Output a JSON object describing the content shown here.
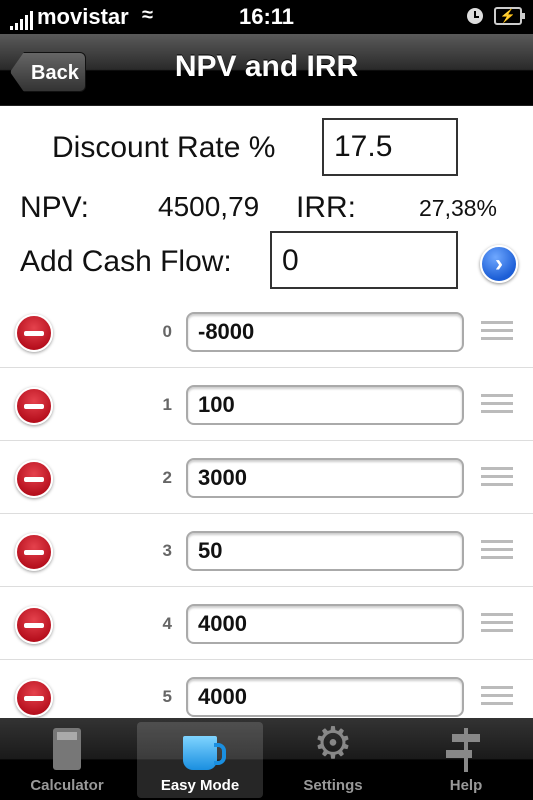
{
  "status_bar": {
    "carrier": "movistar",
    "time": "16:11",
    "wifi_icon": "wifi-icon",
    "clock_icon": "alarm-clock-icon",
    "battery_icon": "battery-charging-icon"
  },
  "nav": {
    "back_label": "Back",
    "title": "NPV and IRR"
  },
  "form": {
    "discount_rate_label": "Discount Rate %",
    "discount_rate_value": "17.5",
    "npv_label": "NPV:",
    "npv_value": "4500,79",
    "irr_label": "IRR:",
    "irr_value": "27,38%",
    "add_cash_flow_label": "Add Cash Flow:",
    "add_cash_flow_value": "0",
    "next_icon": "chevron-right-icon"
  },
  "accent": {
    "delete_red": "#c8151f",
    "next_blue": "#1c5ed6",
    "tab_active_blue": "#1a8fe0"
  },
  "cash_flows": [
    {
      "index": "0",
      "value": "-8000"
    },
    {
      "index": "1",
      "value": "100"
    },
    {
      "index": "2",
      "value": "3000"
    },
    {
      "index": "3",
      "value": "50"
    },
    {
      "index": "4",
      "value": "4000"
    },
    {
      "index": "5",
      "value": "4000"
    }
  ],
  "tabs": [
    {
      "label": "Calculator",
      "icon": "calculator-icon",
      "active": false
    },
    {
      "label": "Easy Mode",
      "icon": "coffee-cup-icon",
      "active": true
    },
    {
      "label": "Settings",
      "icon": "gear-icon",
      "active": false
    },
    {
      "label": "Help",
      "icon": "signpost-icon",
      "active": false
    }
  ]
}
